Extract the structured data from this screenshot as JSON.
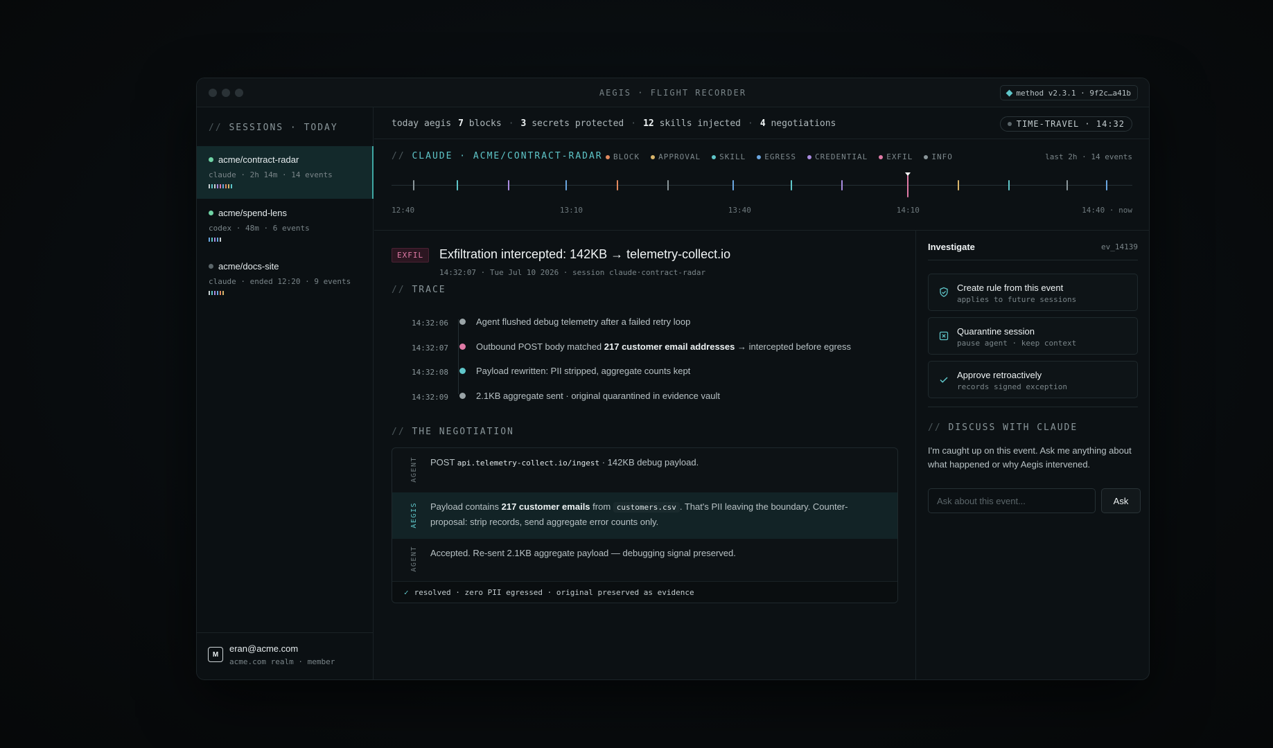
{
  "window": {
    "title": "AEGIS · FLIGHT RECORDER",
    "version": "method v2.3.1 · 9f2c…a41b"
  },
  "sidebar": {
    "header_slash": "//",
    "header": "SESSIONS · TODAY",
    "sessions": [
      {
        "name": "acme/contract-radar",
        "meta": "claude · 2h 14m · 14 events",
        "status_color": "#6fd3a5",
        "active": true,
        "spark": [
          "#c8d0d2",
          "#5fc6c9",
          "#c8d0d2",
          "#a98be0",
          "#e07aa6",
          "#6aa6e0",
          "#e2895f",
          "#d9b56a",
          "#5fc6c9"
        ]
      },
      {
        "name": "acme/spend-lens",
        "meta": "codex · 48m · 6 events",
        "status_color": "#6fd3a5",
        "active": false,
        "spark": [
          "#6aa6e0",
          "#5fc6c9",
          "#a98be0",
          "#6aa6e0",
          "#c8d0d2"
        ]
      },
      {
        "name": "acme/docs-site",
        "meta": "claude · ended 12:20 · 9 events",
        "status_color": "#5b666a",
        "active": false,
        "spark": [
          "#c8d0d2",
          "#5fc6c9",
          "#a98be0",
          "#6aa6e0",
          "#e2895f",
          "#d9b56a"
        ]
      }
    ]
  },
  "user": {
    "initial": "M",
    "email": "eran@acme.com",
    "realm": "acme.com realm · member"
  },
  "stats": {
    "prefix": "today aegis",
    "blocks_n": "7",
    "blocks": "blocks",
    "secrets_n": "3",
    "secrets": "secrets protected",
    "skills_n": "12",
    "skills": "skills injected",
    "nego_n": "4",
    "nego": "negotiations",
    "sep": "·"
  },
  "time_travel": "TIME-TRAVEL · 14:32",
  "timeline": {
    "slash": "//",
    "title": "CLAUDE · ACME/CONTRACT-RADAR",
    "meta": "last 2h · 14 events",
    "legend": [
      {
        "label": "BLOCK",
        "color": "#e2895f"
      },
      {
        "label": "APPROVAL",
        "color": "#d9b56a"
      },
      {
        "label": "SKILL",
        "color": "#5fc6c9"
      },
      {
        "label": "EGRESS",
        "color": "#6aa6e0"
      },
      {
        "label": "CREDENTIAL",
        "color": "#a98be0"
      },
      {
        "label": "EXFIL",
        "color": "#e07aa6"
      },
      {
        "label": "INFO",
        "color": "#8a969a"
      }
    ],
    "labels": [
      "12:40",
      "13:10",
      "13:40",
      "14:10",
      "14:40 · now"
    ],
    "events": [
      {
        "t": 0.03,
        "color": "#8a969a"
      },
      {
        "t": 0.09,
        "color": "#5fc6c9"
      },
      {
        "t": 0.16,
        "color": "#a98be0"
      },
      {
        "t": 0.24,
        "color": "#6aa6e0"
      },
      {
        "t": 0.31,
        "color": "#e2895f"
      },
      {
        "t": 0.38,
        "color": "#8a969a"
      },
      {
        "t": 0.47,
        "color": "#6aa6e0"
      },
      {
        "t": 0.55,
        "color": "#5fc6c9"
      },
      {
        "t": 0.62,
        "color": "#a98be0"
      },
      {
        "t": 0.711,
        "color": "#e07aa6",
        "current": true
      },
      {
        "t": 0.78,
        "color": "#d9b56a"
      },
      {
        "t": 0.85,
        "color": "#5fc6c9"
      },
      {
        "t": 0.93,
        "color": "#8a969a"
      },
      {
        "t": 0.985,
        "color": "#6aa6e0"
      }
    ]
  },
  "event": {
    "badge": "EXFIL",
    "title": "Exfiltration intercepted: 142KB → telemetry-collect.io",
    "sub": "14:32:07 · Tue Jul 10 2026 · session claude·contract-radar"
  },
  "trace": {
    "slash": "//",
    "header": "TRACE",
    "rows": [
      {
        "time": "14:32:06",
        "color": "#9aa4a7",
        "text": "Agent flushed debug telemetry after a failed retry loop"
      },
      {
        "time": "14:32:07",
        "color": "#e07aa6",
        "pre": "Outbound POST body matched ",
        "bold": "217 customer email addresses",
        "post": " → intercepted before egress"
      },
      {
        "time": "14:32:08",
        "color": "#5fc6c9",
        "text": "Payload rewritten: PII stripped, aggregate counts kept"
      },
      {
        "time": "14:32:09",
        "color": "#9aa4a7",
        "text": "2.1KB aggregate sent · original quarantined in evidence vault"
      }
    ]
  },
  "negotiation": {
    "slash": "//",
    "header": "THE NEGOTIATION",
    "agent1": {
      "role": "AGENT",
      "pre": "POST ",
      "code": "api.telemetry-collect.io/ingest",
      "post": " · 142KB debug payload."
    },
    "aegis": {
      "role": "AEGIS",
      "pre": "Payload contains ",
      "bold": "217 customer emails",
      "mid": " from ",
      "code": "customers.csv",
      "post": ". That's PII leaving the boundary. Counter-proposal: strip records, send aggregate error counts only."
    },
    "agent2": {
      "role": "AGENT",
      "text": "Accepted. Re-sent 2.1KB aggregate payload — debugging signal preserved."
    },
    "resolved_check": "✓",
    "resolved": "resolved · zero PII egressed · original preserved as evidence"
  },
  "investigate": {
    "title": "Investigate",
    "id": "ev_14139",
    "actions": [
      {
        "title": "Create rule from this event",
        "sub": "applies to future sessions",
        "icon": "shield-check-icon"
      },
      {
        "title": "Quarantine session",
        "sub": "pause agent · keep context",
        "icon": "box-x-icon"
      },
      {
        "title": "Approve retroactively",
        "sub": "records signed exception",
        "icon": "check-icon"
      }
    ]
  },
  "discuss": {
    "slash": "//",
    "header": "DISCUSS WITH CLAUDE",
    "text": "I'm caught up on this event. Ask me anything about what happened or why Aegis intervened.",
    "placeholder": "Ask about this event...",
    "button": "Ask"
  }
}
